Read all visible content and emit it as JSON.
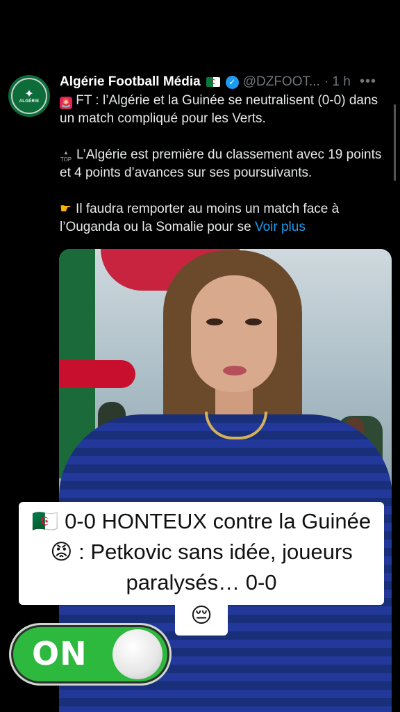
{
  "tweet": {
    "author": "Algérie Football Média",
    "handle": "@DZFOOT...",
    "time": "· 1 h",
    "more": "•••",
    "avatar_text": "ALGÉRIE",
    "line1": "FT : l’Algérie et la Guinée se neutralisent (0-0) dans un match compliqué pour les Verts.",
    "line2": "L’Algérie est première du classement avec 19 points et 4 points d’avances sur ses poursuivants.",
    "line3": "Il faudra remporter au moins un match face à l’Ouganda ou la Somalie pour se",
    "see_more": "Voir plus",
    "top_label": "TOP"
  },
  "overlay": {
    "caption_main": "🇩🇿 0-0 HONTEUX contre la Guinée 😡 : Petkovic sans idée, joueurs paralysés… 0-0",
    "caption_tail": "😔",
    "toggle_label": "ON"
  },
  "colors": {
    "link": "#1d9bf0",
    "verified": "#1d9bf0",
    "toggle_on": "#2db83e"
  }
}
